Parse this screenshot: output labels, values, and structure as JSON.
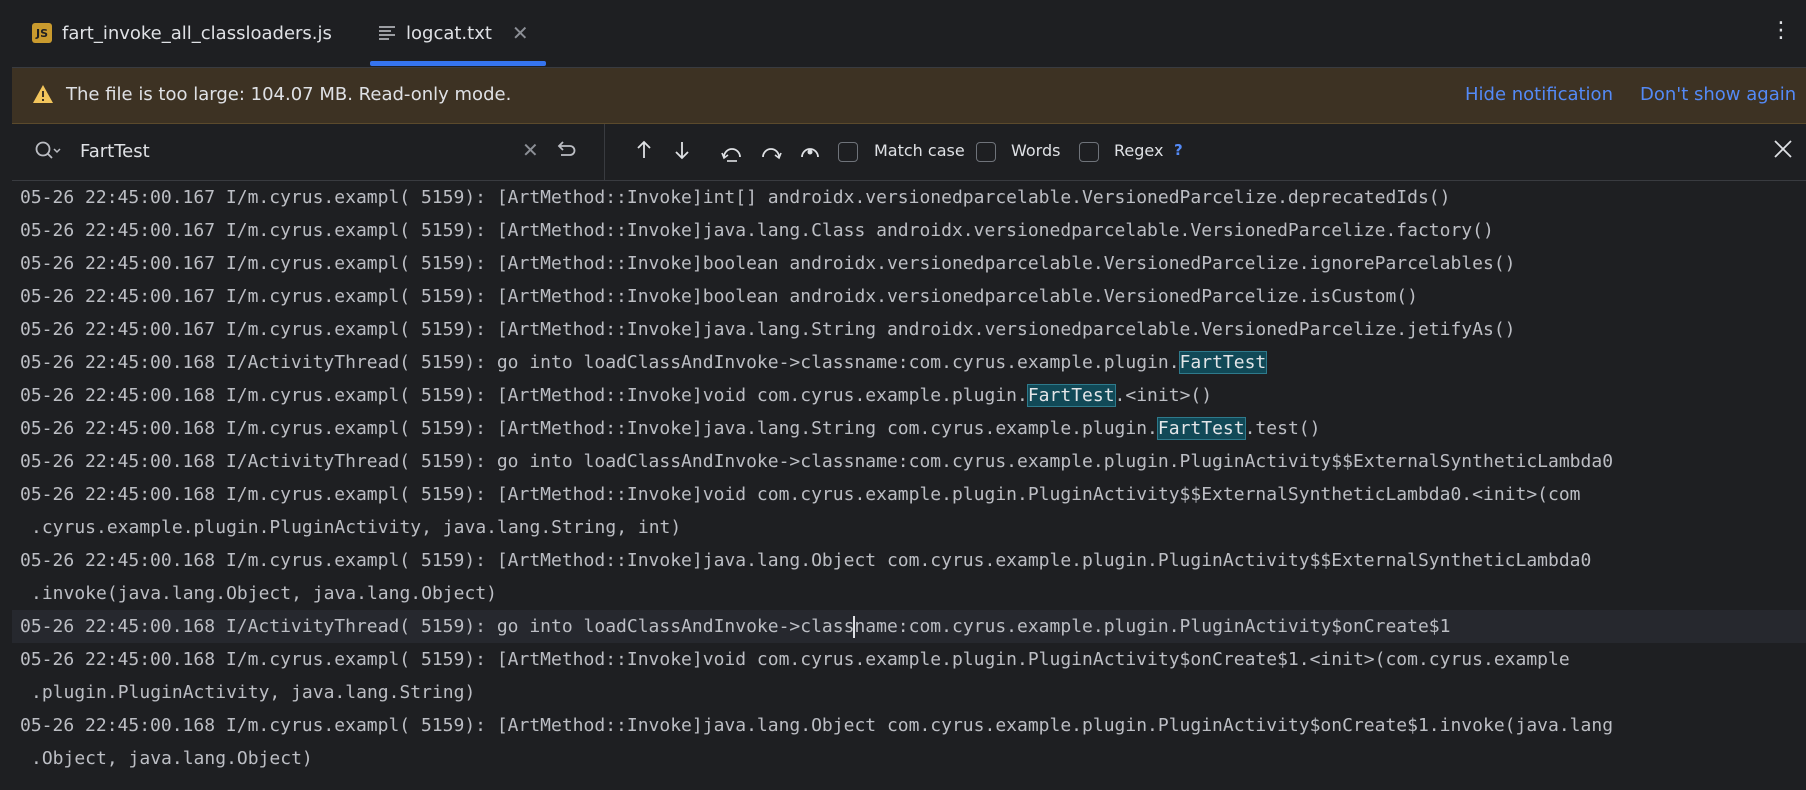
{
  "tabs": [
    {
      "label": "fart_invoke_all_classloaders.js",
      "icon": "js-file-icon"
    },
    {
      "label": "logcat.txt",
      "icon": "text-file-icon",
      "active": true
    }
  ],
  "notification": {
    "message": "The file is too large: 104.07 MB. Read-only mode.",
    "hide_link": "Hide notification",
    "dont_show_link": "Don't show again"
  },
  "search": {
    "query": "FartTest",
    "match_case_label": "Match case",
    "words_label": "Words",
    "regex_label": "Regex",
    "help_label": "?"
  },
  "colors": {
    "accent": "#3574f0",
    "link": "#548af7",
    "highlight_bg": "#114957",
    "notification_bg": "#3d3223",
    "warning": "#f2c55c"
  },
  "log": {
    "lines": [
      {
        "text": "05-26 22:45:00.167 I/m.cyrus.exampl( 5159): [ArtMethod::Invoke]int[] androidx.versionedparcelable.VersionedParcelize.deprecatedIds()"
      },
      {
        "text": "05-26 22:45:00.167 I/m.cyrus.exampl( 5159): [ArtMethod::Invoke]java.lang.Class androidx.versionedparcelable.VersionedParcelize.factory()"
      },
      {
        "text": "05-26 22:45:00.167 I/m.cyrus.exampl( 5159): [ArtMethod::Invoke]boolean androidx.versionedparcelable.VersionedParcelize.ignoreParcelables()"
      },
      {
        "text": "05-26 22:45:00.167 I/m.cyrus.exampl( 5159): [ArtMethod::Invoke]boolean androidx.versionedparcelable.VersionedParcelize.isCustom()"
      },
      {
        "text": "05-26 22:45:00.167 I/m.cyrus.exampl( 5159): [ArtMethod::Invoke]java.lang.String androidx.versionedparcelable.VersionedParcelize.jetifyAs()"
      },
      {
        "before": "05-26 22:45:00.168 I/ActivityThread( 5159): go into loadClassAndInvoke->classname:com.cyrus.example.plugin.",
        "match": "FartTest",
        "after": ""
      },
      {
        "before": "05-26 22:45:00.168 I/m.cyrus.exampl( 5159): [ArtMethod::Invoke]void com.cyrus.example.plugin.",
        "match": "FartTest",
        "after": ".<init>()"
      },
      {
        "before": "05-26 22:45:00.168 I/m.cyrus.exampl( 5159): [ArtMethod::Invoke]java.lang.String com.cyrus.example.plugin.",
        "match": "FartTest",
        "after": ".test()"
      },
      {
        "text": "05-26 22:45:00.168 I/ActivityThread( 5159): go into loadClassAndInvoke->classname:com.cyrus.example.plugin.PluginActivity$$ExternalSyntheticLambda0"
      },
      {
        "text": "05-26 22:45:00.168 I/m.cyrus.exampl( 5159): [ArtMethod::Invoke]void com.cyrus.example.plugin.PluginActivity$$ExternalSyntheticLambda0.<init>(com",
        "cont": ".cyrus.example.plugin.PluginActivity, java.lang.String, int)"
      },
      {
        "text": "05-26 22:45:00.168 I/m.cyrus.exampl( 5159): [ArtMethod::Invoke]java.lang.Object com.cyrus.example.plugin.PluginActivity$$ExternalSyntheticLambda0",
        "cont": ".invoke(java.lang.Object, java.lang.Object)"
      },
      {
        "caret_before": "05-26 22:45:00.168 I/ActivityThread( 5159): go into loadClassAndInvoke->class",
        "caret_after": "name:com.cyrus.example.plugin.PluginActivity$onCreate$1",
        "current": true
      },
      {
        "text": "05-26 22:45:00.168 I/m.cyrus.exampl( 5159): [ArtMethod::Invoke]void com.cyrus.example.plugin.PluginActivity$onCreate$1.<init>(com.cyrus.example",
        "cont": ".plugin.PluginActivity, java.lang.String)"
      },
      {
        "text": "05-26 22:45:00.168 I/m.cyrus.exampl( 5159): [ArtMethod::Invoke]java.lang.Object com.cyrus.example.plugin.PluginActivity$onCreate$1.invoke(java.lang",
        "cont": ".Object, java.lang.Object)"
      }
    ]
  }
}
